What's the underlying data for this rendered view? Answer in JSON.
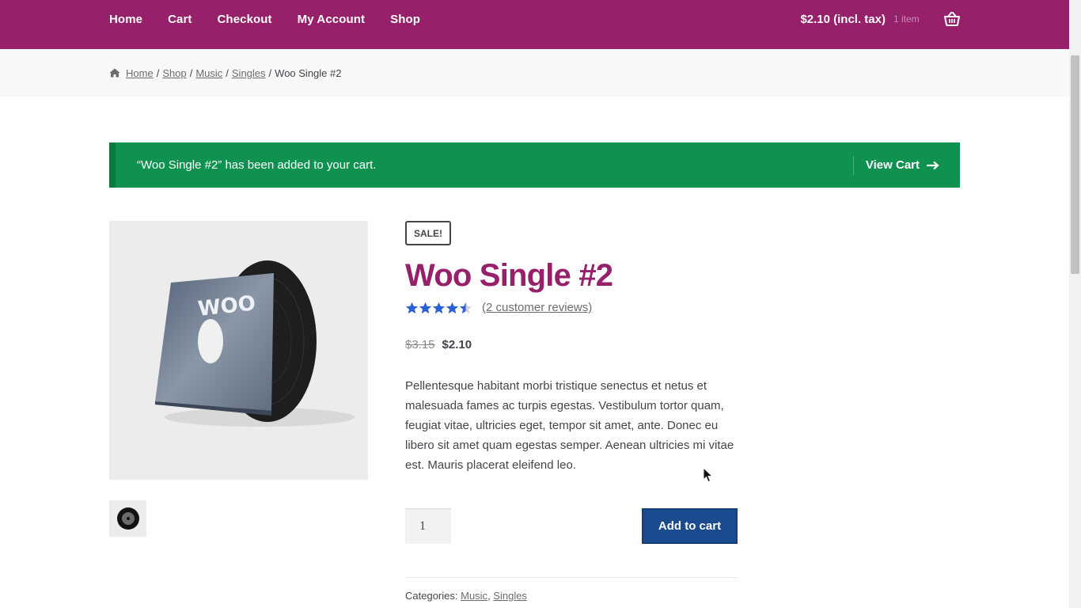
{
  "nav": {
    "items": [
      {
        "label": "Home"
      },
      {
        "label": "Cart"
      },
      {
        "label": "Checkout"
      },
      {
        "label": "My Account"
      },
      {
        "label": "Shop"
      }
    ],
    "cart_total": "$2.10 (incl. tax)",
    "cart_count": "1 item",
    "basket_icon": "shopping-basket-icon"
  },
  "breadcrumb": {
    "items": [
      {
        "label": "Home"
      },
      {
        "label": "Shop"
      },
      {
        "label": "Music"
      },
      {
        "label": "Singles"
      }
    ],
    "current": "Woo Single #2",
    "separator": "/"
  },
  "notice": {
    "message": "“Woo Single #2” has been added to your cart.",
    "action_label": "View Cart"
  },
  "product": {
    "sale_badge": "SALE!",
    "title": "Woo Single #2",
    "rating": 4.5,
    "rating_max": 5,
    "reviews_label": "(2 customer reviews)",
    "price_old": "$3.15",
    "price_new": "$2.10",
    "description": "Pellentesque habitant morbi tristique senectus et netus et malesuada fames ac turpis egestas. Vestibulum tortor quam, feugiat vitae, ultricies eget, tempor sit amet, ante. Donec eu libero sit amet quam egestas semper. Aenean ultricies mi vitae est. Mauris placerat eleifend leo.",
    "quantity": "1",
    "add_to_cart_label": "Add to cart",
    "image_text": "WOO",
    "categories_label": "Categories:",
    "categories": [
      "Music",
      "Singles"
    ]
  },
  "colors": {
    "brand": "#96206a",
    "notice": "#0f9250",
    "button": "#1b4b8f",
    "star": "#2c5fd6"
  }
}
